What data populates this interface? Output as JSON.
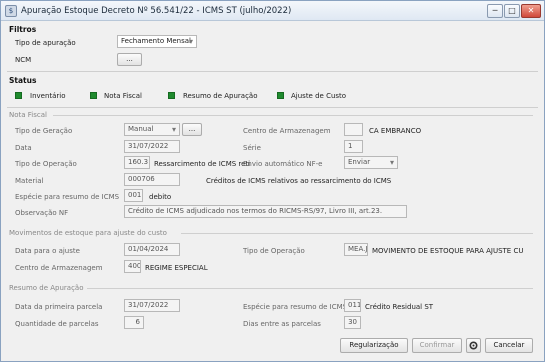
{
  "window": {
    "title": "Apuração Estoque Decreto Nº 56.541/22 - ICMS ST (julho/2022)",
    "buttons": {
      "minimize": "─",
      "maximize": "□",
      "close": "✕"
    }
  },
  "filtros": {
    "title": "Filtros",
    "tipo_apuracao_label": "Tipo de apuração",
    "tipo_apuracao_value": "Fechamento Mensal",
    "ncm_label": "NCM",
    "ncm_button": "..."
  },
  "status": {
    "title": "Status",
    "items": [
      "Inventário",
      "Nota Fiscal",
      "Resumo de Apuração",
      "Ajuste de Custo"
    ],
    "color": "#1f8a2e"
  },
  "nota_fiscal": {
    "title": "Nota Fiscal",
    "tipo_geracao_label": "Tipo de Geração",
    "tipo_geracao_value": "Manual",
    "tipo_geracao_button": "...",
    "centro_label": "Centro de Armazenagem",
    "centro_value": "",
    "centro_desc": "CA EMBRANCO",
    "data_label": "Data",
    "data_value": "31/07/2022",
    "serie_label": "Série",
    "serie_value": "1",
    "tipo_operacao_label": "Tipo de Operação",
    "tipo_operacao_code": "160.3",
    "tipo_operacao_desc": "Ressarcimento de ICMS reti",
    "envio_label": "Envio automático NF-e",
    "envio_value": "Enviar",
    "material_label": "Material",
    "material_code": "000706",
    "material_desc": "Créditos de ICMS relativos ao ressarcimento do ICMS",
    "especie_label": "Espécie para resumo de ICMS",
    "especie_code": "001",
    "especie_desc": "debito",
    "observacao_label": "Observação NF",
    "observacao_value": "Crédito de ICMS adjudicado nos termos do RICMS-RS/97, Livro III, art.23."
  },
  "movimentos": {
    "title": "Movimentos de estoque para ajuste do custo",
    "data_label": "Data para o ajuste",
    "data_value": "01/04/2024",
    "tipo_operacao_label": "Tipo de Operação",
    "tipo_operacao_code": "MEA.J",
    "tipo_operacao_desc": "MOVIMENTO DE ESTOQUE PARA AJUSTE CUSTO",
    "centro_label": "Centro de Armazenagem",
    "centro_code": "400",
    "centro_desc": "REGIME ESPECIAL"
  },
  "resumo": {
    "title": "Resumo de Apuração",
    "data_label": "Data da primeira parcela",
    "data_value": "31/07/2022",
    "especie_label": "Espécie para resumo de ICMS",
    "especie_code": "011",
    "especie_desc": "Crédito Residual ST",
    "qtd_label": "Quantidade de parcelas",
    "qtd_value": "6",
    "dias_label": "Dias entre as parcelas",
    "dias_value": "30"
  },
  "footer": {
    "regularizacao": "Regularização",
    "confirmar": "Confirmar",
    "cancelar": "Cancelar"
  }
}
